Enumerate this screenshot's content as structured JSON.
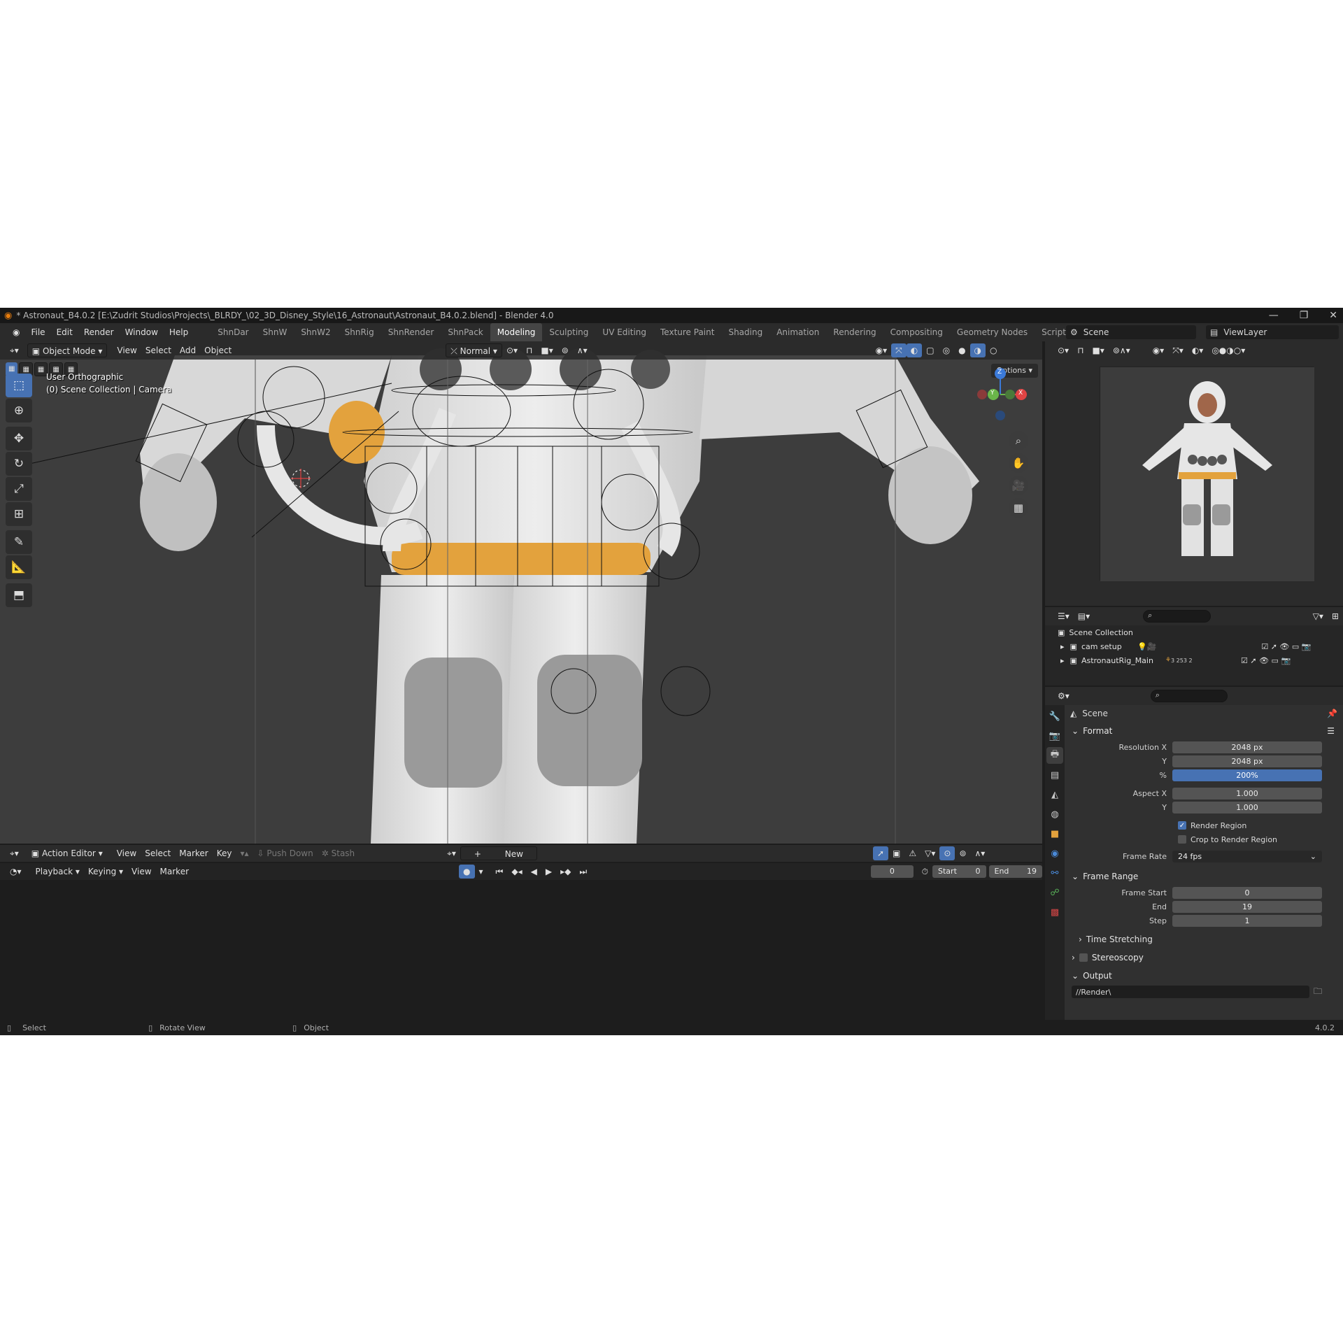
{
  "window": {
    "title": "* Astronaut_B4.0.2 [E:\\Zudrit Studios\\Projects\\_BLRDY_\\02_3D_Disney_Style\\16_Astronaut\\Astronaut_B4.0.2.blend] - Blender 4.0"
  },
  "menubar": {
    "menus": [
      "File",
      "Edit",
      "Render",
      "Window",
      "Help"
    ],
    "workspaces": [
      "ShnDar",
      "ShnW",
      "ShnW2",
      "ShnRig",
      "ShnRender",
      "ShnPack",
      "Modeling",
      "Sculpting",
      "UV Editing",
      "Texture Paint",
      "Shading",
      "Animation",
      "Rendering",
      "Compositing",
      "Geometry Nodes",
      "Scripting"
    ],
    "active_workspace": "Modeling",
    "add_tab": "+",
    "scene": "Scene",
    "view_layer": "ViewLayer"
  },
  "viewport": {
    "mode": "Object Mode",
    "menus": [
      "View",
      "Select",
      "Add",
      "Object"
    ],
    "orientation": "Normal",
    "options": "Options",
    "view_name": "User Orthographic",
    "collection_info": "(0) Scene Collection | Camera",
    "gizmo_axes": {
      "x": "X",
      "y": "Y",
      "z": "Z"
    }
  },
  "action_editor": {
    "editor": "Action Editor",
    "menus": [
      "View",
      "Select",
      "Marker",
      "Key"
    ],
    "push_down": "Push Down",
    "stash": "Stash",
    "new": "New"
  },
  "timeline": {
    "playback": "Playback",
    "keying": "Keying",
    "menus": [
      "View",
      "Marker"
    ],
    "current_frame": "0",
    "start_label": "Start",
    "start_value": "0",
    "end_label": "End",
    "end_value": "19"
  },
  "statusbar": {
    "select": "Select",
    "rotate": "Rotate View",
    "object": "Object",
    "version": "4.0.2"
  },
  "outliner": {
    "root": "Scene Collection",
    "items": [
      {
        "name": "cam setup",
        "badge": ""
      },
      {
        "name": "AstronautRig_Main",
        "badge": "3 253 2"
      }
    ]
  },
  "properties": {
    "context": "Scene",
    "format": {
      "title": "Format",
      "resolution_x_label": "Resolution X",
      "resolution_x": "2048 px",
      "resolution_y_label": "Y",
      "resolution_y": "2048 px",
      "percent_label": "%",
      "percent": "200%",
      "aspect_x_label": "Aspect X",
      "aspect_x": "1.000",
      "aspect_y_label": "Y",
      "aspect_y": "1.000",
      "render_region": "Render Region",
      "crop_region": "Crop to Render Region",
      "frame_rate_label": "Frame Rate",
      "frame_rate": "24 fps"
    },
    "frame_range": {
      "title": "Frame Range",
      "start_label": "Frame Start",
      "start": "0",
      "end_label": "End",
      "end": "19",
      "step_label": "Step",
      "step": "1",
      "time_stretching": "Time Stretching"
    },
    "stereoscopy": "Stereoscopy",
    "output": {
      "title": "Output",
      "path": "//Render\\"
    }
  }
}
